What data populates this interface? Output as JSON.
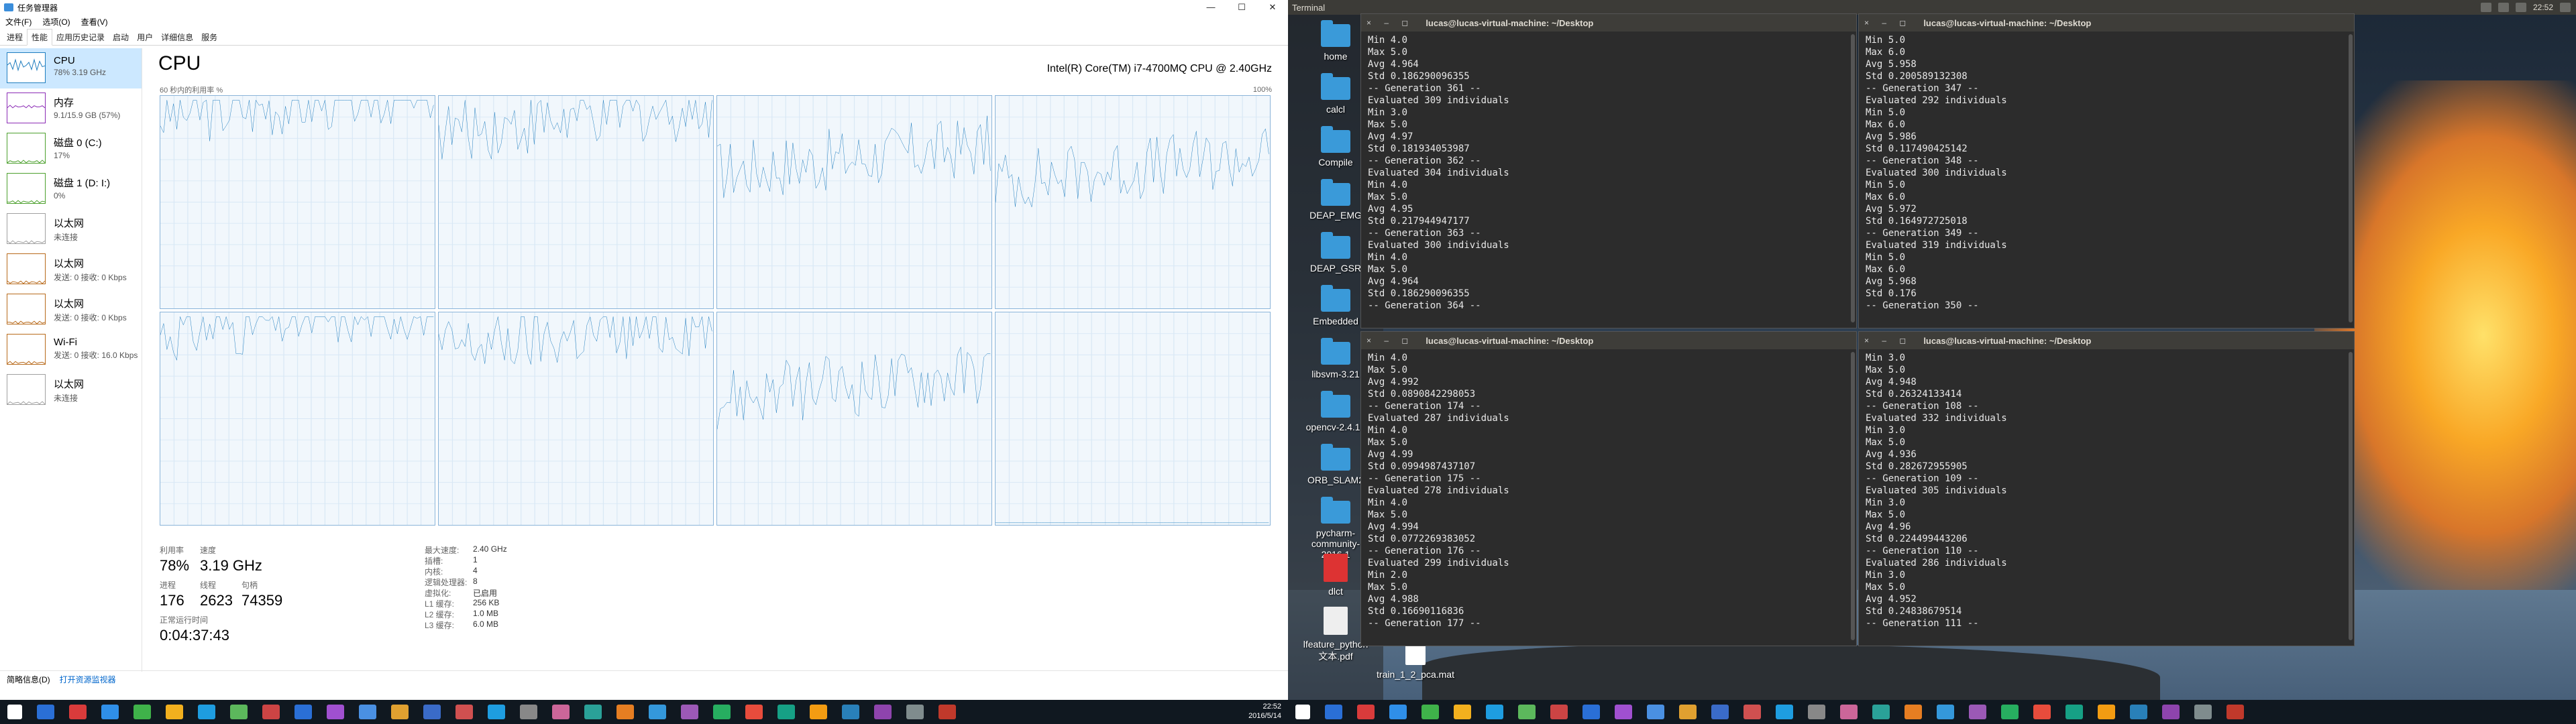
{
  "left": {
    "window_title": "任务管理器",
    "window_buttons": [
      "—",
      "☐",
      "✕"
    ],
    "menu": [
      "文件(F)",
      "选项(O)",
      "查看(V)"
    ],
    "tabs": [
      "进程",
      "性能",
      "应用历史记录",
      "启动",
      "用户",
      "详细信息",
      "服务"
    ],
    "active_tab": "性能",
    "sidebar": [
      {
        "name": "CPU",
        "sub": "78% 3.19 GHz",
        "color": "#1f7dbf",
        "selected": true
      },
      {
        "name": "内存",
        "sub": "9.1/15.9 GB (57%)",
        "color": "#8b2bb5"
      },
      {
        "name": "磁盘 0 (C:)",
        "sub": "17%",
        "color": "#4ca02d"
      },
      {
        "name": "磁盘 1 (D: I:)",
        "sub": "0%",
        "color": "#4ca02d"
      },
      {
        "name": "以太网",
        "sub": "未连接",
        "color": "#a0a0a0"
      },
      {
        "name": "以太网",
        "sub": "发送: 0 接收: 0 Kbps",
        "color": "#b86a1b"
      },
      {
        "name": "以太网",
        "sub": "发送: 0 接收: 0 Kbps",
        "color": "#b86a1b"
      },
      {
        "name": "Wi-Fi",
        "sub": "发送: 0 接收: 16.0 Kbps",
        "color": "#b86a1b"
      },
      {
        "name": "以太网",
        "sub": "未连接",
        "color": "#a0a0a0"
      }
    ],
    "cpu_title": "CPU",
    "cpu_model": "Intel(R) Core(TM) i7-4700MQ CPU @ 2.40GHz",
    "util_label": "60 秒内的利用率 %",
    "pct_label": "100%",
    "stats": {
      "util_label": "利用率",
      "util": "78%",
      "speed_label": "速度",
      "speed": "3.19 GHz",
      "proc_label": "进程",
      "proc": "176",
      "thread_label": "线程",
      "thread": "2623",
      "handle_label": "句柄",
      "handle": "74359",
      "uptime_label": "正常运行时间",
      "uptime": "0:04:37:43"
    },
    "specs": [
      {
        "k": "最大速度:",
        "v": "2.40 GHz"
      },
      {
        "k": "插槽:",
        "v": "1"
      },
      {
        "k": "内核:",
        "v": "4"
      },
      {
        "k": "逻辑处理器:",
        "v": "8"
      },
      {
        "k": "虚拟化:",
        "v": "已启用"
      },
      {
        "k": "L1 缓存:",
        "v": "256 KB"
      },
      {
        "k": "L2 缓存:",
        "v": "1.0 MB"
      },
      {
        "k": "L3 缓存:",
        "v": "6.0 MB"
      }
    ],
    "footer_brief": "简略信息(D)",
    "footer_link": "打开资源监视器",
    "clock_time": "22:52",
    "clock_date": "2016/5/14"
  },
  "right": {
    "panel_title": "Terminal",
    "clock": "22:52",
    "desktop_icons": [
      "home",
      "calcl",
      "Compile",
      "DEAP_EMG",
      "DEAP_GSR",
      "Embedded",
      "libsvm-3.21",
      "opencv-2.4.13",
      "ORB_SLAM2",
      "pycharm-community-2016.1",
      "dlct",
      "lfeature_python文本.pdf"
    ],
    "desktop_file": "train_1_2_pca.mat",
    "term_title": "lucas@lucas-virtual-machine: ~/Desktop",
    "term_btns": "× – ◻",
    "terminals": [
      [
        "Min 4.0",
        "Max 5.0",
        "Avg 4.964",
        "Std 0.186290096355",
        "-- Generation 361 --",
        "Evaluated 309 individuals",
        "Min 3.0",
        "Max 5.0",
        "Avg 4.97",
        "Std 0.181934053987",
        "-- Generation 362 --",
        "Evaluated 304 individuals",
        "Min 4.0",
        "Max 5.0",
        "Avg 4.95",
        "Std 0.217944947177",
        "-- Generation 363 --",
        "Evaluated 300 individuals",
        "Min 4.0",
        "Max 5.0",
        "Avg 4.964",
        "Std 0.186290096355",
        "-- Generation 364 --"
      ],
      [
        "Min 5.0",
        "Max 6.0",
        "Avg 5.958",
        "Std 0.200589132308",
        "-- Generation 347 --",
        "Evaluated 292 individuals",
        "Min 5.0",
        "Max 6.0",
        "Avg 5.986",
        "Std 0.117490425142",
        "-- Generation 348 --",
        "Evaluated 300 individuals",
        "Min 5.0",
        "Max 6.0",
        "Avg 5.972",
        "Std 0.164972725018",
        "-- Generation 349 --",
        "Evaluated 319 individuals",
        "Min 5.0",
        "Max 6.0",
        "Avg 5.968",
        "Std 0.176",
        "-- Generation 350 --"
      ],
      [
        "Min 4.0",
        "Max 5.0",
        "Avg 4.992",
        "Std 0.0890842298053",
        "-- Generation 174 --",
        "Evaluated 287 individuals",
        "Min 4.0",
        "Max 5.0",
        "Avg 4.99",
        "Std 0.0994987437107",
        "-- Generation 175 --",
        "Evaluated 278 individuals",
        "Min 4.0",
        "Max 5.0",
        "Avg 4.994",
        "Std 0.0772269383052",
        "-- Generation 176 --",
        "Evaluated 299 individuals",
        "Min 2.0",
        "Max 5.0",
        "Avg 4.988",
        "Std 0.16690116836",
        "-- Generation 177 --"
      ],
      [
        "Min 3.0",
        "Max 5.0",
        "Avg 4.948",
        "Std 0.26324133414",
        "-- Generation 108 --",
        "Evaluated 332 individuals",
        "Min 3.0",
        "Max 5.0",
        "Avg 4.936",
        "Std 0.282672955905",
        "-- Generation 109 --",
        "Evaluated 305 individuals",
        "Min 3.0",
        "Max 5.0",
        "Avg 4.96",
        "Std 0.224499443206",
        "-- Generation 110 --",
        "Evaluated 286 individuals",
        "Min 3.0",
        "Max 5.0",
        "Avg 4.952",
        "Std 0.24838679514",
        "-- Generation 111 --"
      ]
    ]
  }
}
